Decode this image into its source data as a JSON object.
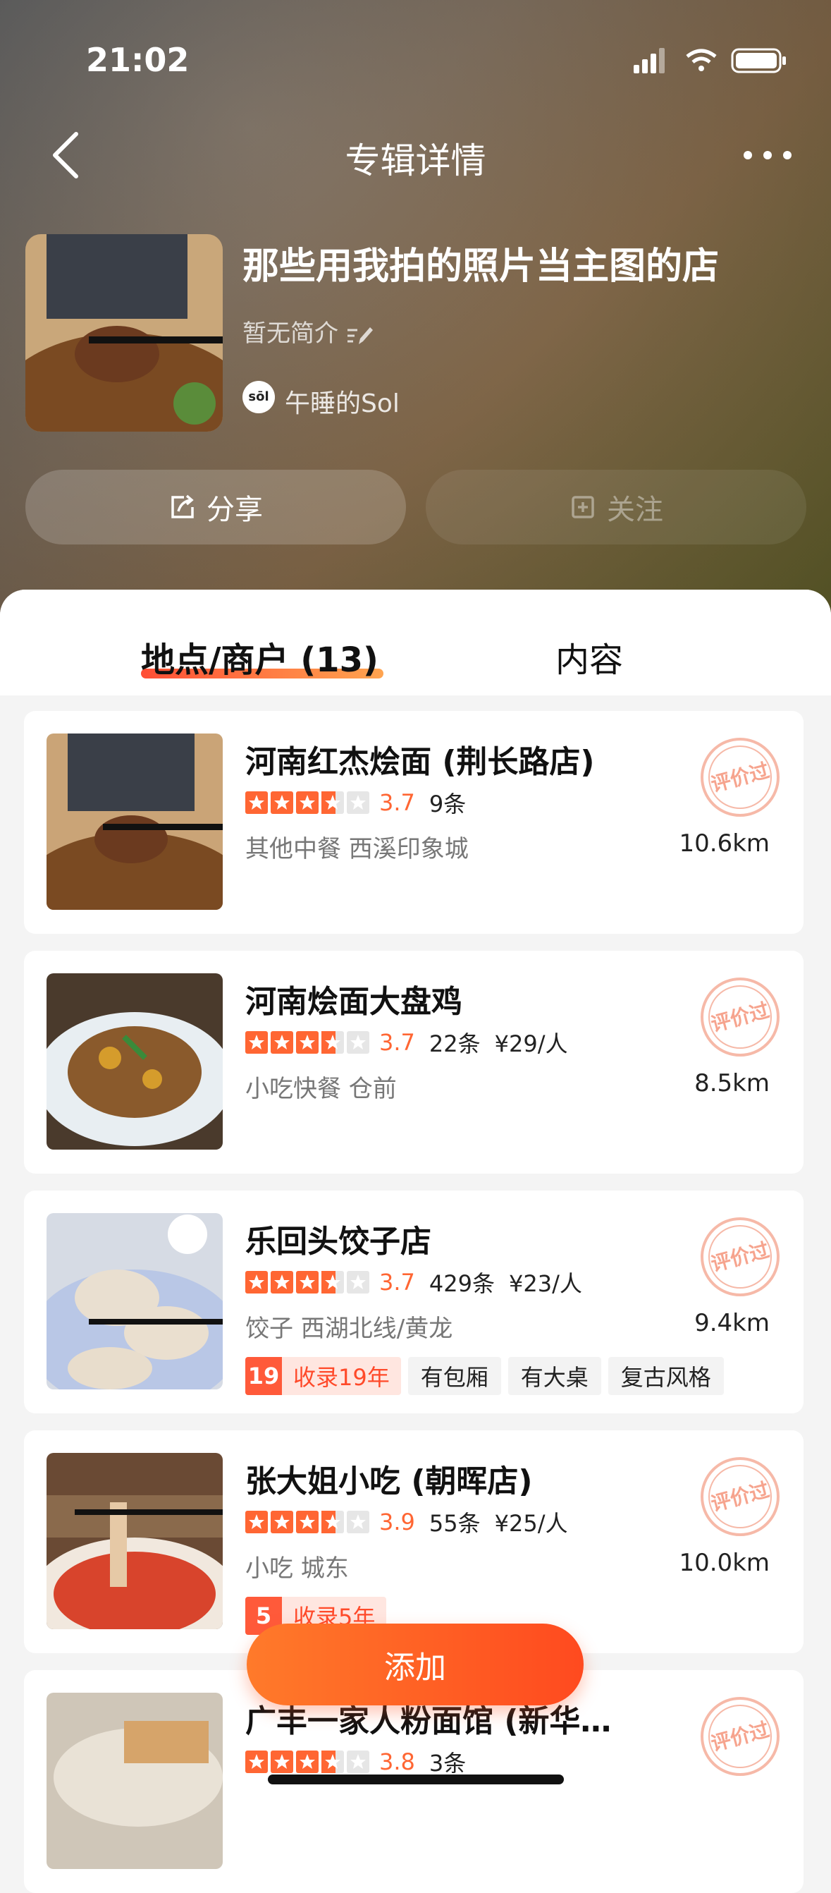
{
  "status": {
    "time": "21:02"
  },
  "nav": {
    "title": "专辑详情"
  },
  "album": {
    "title": "那些用我拍的照片当主图的店",
    "description": "暂无简介",
    "author_avatar_text": "sōl",
    "author": "午睡的Sol"
  },
  "actions": {
    "share": "分享",
    "follow": "关注"
  },
  "tabs": {
    "places": "地点/商户 (13)",
    "content": "内容"
  },
  "stamp_text": "评价过",
  "items": [
    {
      "name": "河南红杰烩面 (荆长路店)",
      "rating": "3.7",
      "reviews": "9条",
      "price": "",
      "category": "其他中餐 西溪印象城",
      "distance": "10.6km"
    },
    {
      "name": "河南烩面大盘鸡",
      "rating": "3.7",
      "reviews": "22条",
      "price": "¥29/人",
      "category": "小吃快餐 仓前",
      "distance": "8.5km"
    },
    {
      "name": "乐回头饺子店",
      "rating": "3.7",
      "reviews": "429条",
      "price": "¥23/人",
      "category": "饺子 西湖北线/黄龙",
      "distance": "9.4km",
      "record_num": "19",
      "record_text": "收录19年",
      "tags": [
        "有包厢",
        "有大桌",
        "复古风格"
      ]
    },
    {
      "name": "张大姐小吃 (朝晖店)",
      "rating": "3.9",
      "reviews": "55条",
      "price": "¥25/人",
      "category": "小吃 城东",
      "distance": "10.0km",
      "record_num": "5",
      "record_text": "收录5年"
    },
    {
      "name": "广丰一家人粉面馆 (新华…",
      "rating": "3.8",
      "reviews": "3条",
      "price": ""
    }
  ],
  "add_button": "添加",
  "colors": {
    "accent": "#ff5a2a",
    "rating": "#ff6633"
  }
}
